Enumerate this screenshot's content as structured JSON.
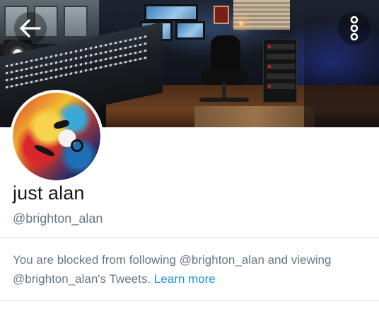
{
  "header": {
    "back_icon": "arrow-left-icon",
    "more_icon": "more-vertical-icon"
  },
  "profile": {
    "display_name": "just alan",
    "handle": "@brighton_alan"
  },
  "blocked_notice": {
    "text_part1": "You are blocked from following",
    "handle_1": "@brighton_alan",
    "text_part2": "and viewing",
    "handle_2_possessive": "@brighton_alan's",
    "text_part3": "Tweets.",
    "learn_more_label": "Learn more"
  },
  "colors": {
    "primary_text": "#14171a",
    "secondary_text": "#657786",
    "link": "#1b95e0",
    "divider": "#d5dbe0"
  }
}
